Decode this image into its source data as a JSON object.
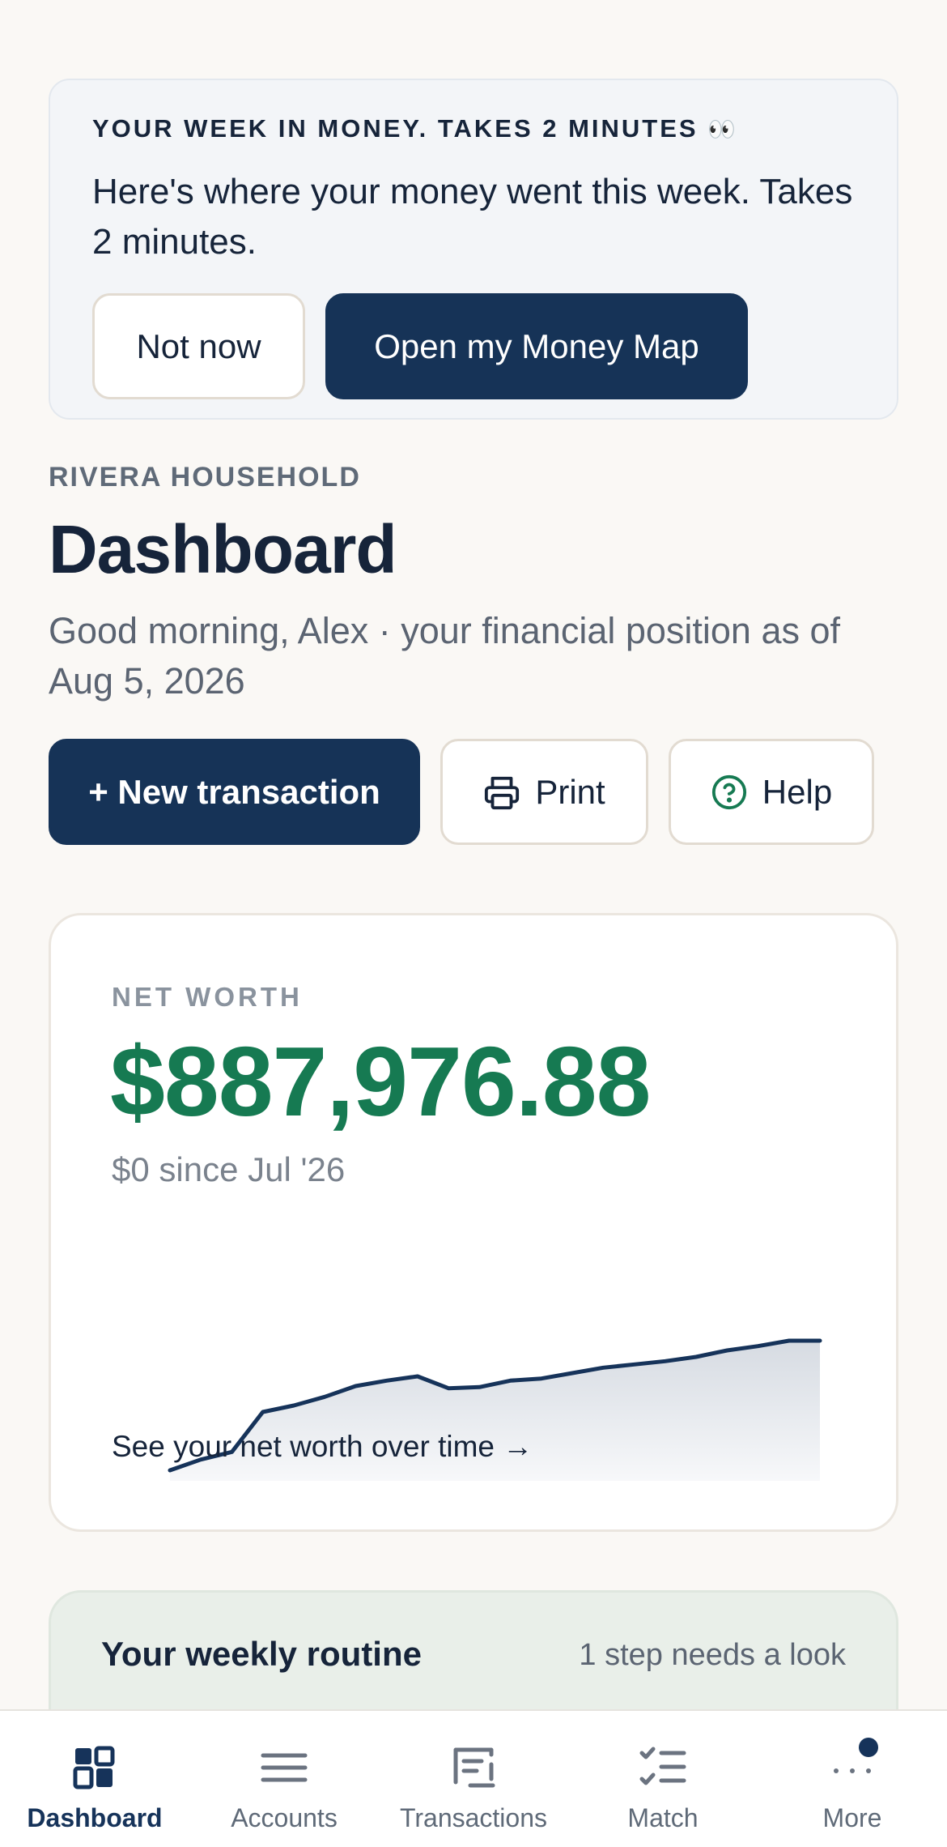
{
  "banner": {
    "eyebrow": "YOUR WEEK IN MONEY. TAKES 2 MINUTES",
    "eyebrow_emoji": "👀",
    "body": "Here's where your money went this week. Takes 2 minutes.",
    "dismiss_label": "Not now",
    "open_label": "Open my Money Map"
  },
  "header": {
    "household": "RIVERA HOUSEHOLD",
    "title": "Dashboard",
    "greeting": "Good morning, Alex · your financial position as of Aug 5, 2026"
  },
  "actions": {
    "new_label": "+ New transaction",
    "print_label": "Print",
    "help_label": "Help",
    "print_icon": "printer-icon",
    "help_icon": "help-circle-icon"
  },
  "net_worth": {
    "label": "NET WORTH",
    "value": "$887,976.88",
    "delta": "$0 since Jul '26",
    "link": "See your net worth over time →",
    "sparkline": [
      0.0,
      0.1,
      0.17,
      0.54,
      0.6,
      0.68,
      0.78,
      0.83,
      0.87,
      0.76,
      0.77,
      0.83,
      0.85,
      0.9,
      0.95,
      0.98,
      1.01,
      1.05,
      1.11,
      1.15,
      1.2,
      1.2
    ],
    "line_color": "#16335a",
    "value_color": "#167a52"
  },
  "routine": {
    "title": "Your weekly routine",
    "status": "1 step needs a look"
  },
  "nav": {
    "items": [
      {
        "label": "Dashboard",
        "icon": "dashboard-icon",
        "active": true
      },
      {
        "label": "Accounts",
        "icon": "menu-icon",
        "active": false
      },
      {
        "label": "Transactions",
        "icon": "transactions-icon",
        "active": false
      },
      {
        "label": "Match",
        "icon": "checklist-icon",
        "active": false
      },
      {
        "label": "More",
        "icon": "more-dots-icon",
        "active": false,
        "badge": true
      }
    ]
  }
}
